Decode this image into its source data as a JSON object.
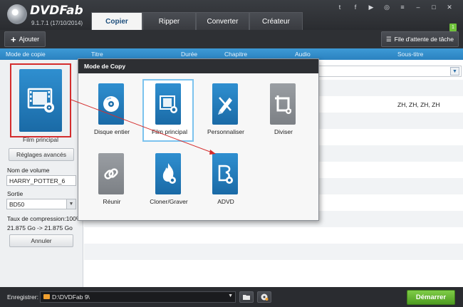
{
  "app": {
    "brand": "DVDFab",
    "version": "9.1.7.1 (17/10/2014)"
  },
  "tabs": [
    {
      "label": "Copier",
      "active": true
    },
    {
      "label": "Ripper",
      "active": false
    },
    {
      "label": "Converter",
      "active": false
    },
    {
      "label": "Créateur",
      "active": false
    }
  ],
  "top_icons": [
    "twitter-icon",
    "facebook-icon",
    "youtube-icon",
    "globe-icon",
    "menu-icon",
    "minimize-icon",
    "restore-icon",
    "close-icon"
  ],
  "toolbar": {
    "add_label": "Ajouter",
    "queue_label": "File d'attente de tâche",
    "queue_badge": "1"
  },
  "columns": {
    "mode": "Mode de copie",
    "title": "Titre",
    "duration": "Durée",
    "chapter": "Chapitre",
    "audio": "Audio",
    "subtitle": "Sous-titre"
  },
  "left": {
    "tile_label": "Film principal",
    "advanced_label": "Réglages avancés",
    "volume_label": "Nom de volume",
    "volume_value": "HARRY_POTTER_6",
    "output_label": "Sortie",
    "output_value": "BD50",
    "compression_label": "Taux de compression:100%",
    "compression_detail": "21.875 Go -> 21.875 Go",
    "cancel_label": "Annuler"
  },
  "table": {
    "subtitle_value": "ZH, ZH, ZH, ZH"
  },
  "popup": {
    "title": "Mode de Copy",
    "items": [
      {
        "label": "Disque entier",
        "icon": "disc-icon",
        "selected": false,
        "enabled": true
      },
      {
        "label": "Film principal",
        "icon": "film-reel-icon",
        "selected": true,
        "enabled": true
      },
      {
        "label": "Personnaliser",
        "icon": "pencil-icon",
        "selected": false,
        "enabled": true
      },
      {
        "label": "Diviser",
        "icon": "crop-icon",
        "selected": false,
        "enabled": false
      },
      {
        "label": "Réunir",
        "icon": "link-icon",
        "selected": false,
        "enabled": false
      },
      {
        "label": "Cloner/Graver",
        "icon": "flame-disc-icon",
        "selected": false,
        "enabled": true
      },
      {
        "label": "ADVD",
        "icon": "bluray-disc-icon",
        "selected": false,
        "enabled": true
      }
    ]
  },
  "statusbar": {
    "save_label": "Enregistrer:",
    "path": "D:\\DVDFab 9\\",
    "start_label": "Démarrer"
  },
  "colors": {
    "accent_blue": "#2b82c0",
    "highlight_red": "#d42d2d",
    "start_green": "#5aa82a",
    "dark_chrome": "#2e3034"
  }
}
